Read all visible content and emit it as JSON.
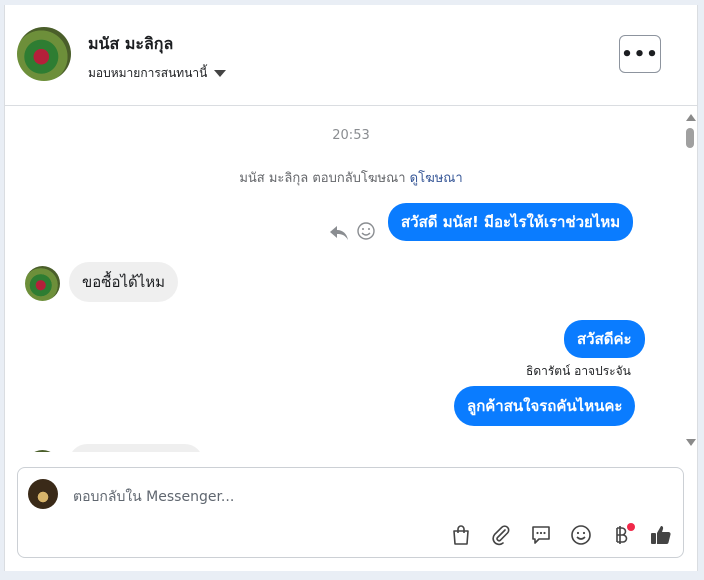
{
  "header": {
    "contact_name": "มนัส มะลิกุล",
    "assign_label": "มอบหมายการสนทนานี้",
    "more_label": "•••"
  },
  "thread": {
    "timestamp": "20:53",
    "system_line": {
      "text": "มนัส มะลิกุล ตอบกลับโฆษณา",
      "link": "ดูโฆษณา"
    },
    "messages": [
      {
        "direction": "outgoing",
        "text": "สวัสดี มนัส! มีอะไรให้เราช่วยไหม"
      },
      {
        "direction": "incoming",
        "text": "ขอซื้อได้ไหม"
      },
      {
        "direction": "outgoing",
        "text": "สวัสดีค่ะ"
      },
      {
        "direction": "outgoing",
        "sender": "ธิดารัตน์ อาจประจัน",
        "text": "ลูกค้าสนใจรถคันไหนคะ"
      }
    ]
  },
  "composer": {
    "placeholder": "ตอบกลับใน Messenger..."
  },
  "toolbar_icons": [
    "shopping-bag-icon",
    "paperclip-icon",
    "saved-reply-icon",
    "emoji-icon",
    "baht-payment-icon",
    "thumbs-up-icon"
  ],
  "colors": {
    "outgoing_bubble": "#0a7cff",
    "incoming_bubble": "#efefef",
    "link": "#385898",
    "notification_dot": "#f02849"
  }
}
